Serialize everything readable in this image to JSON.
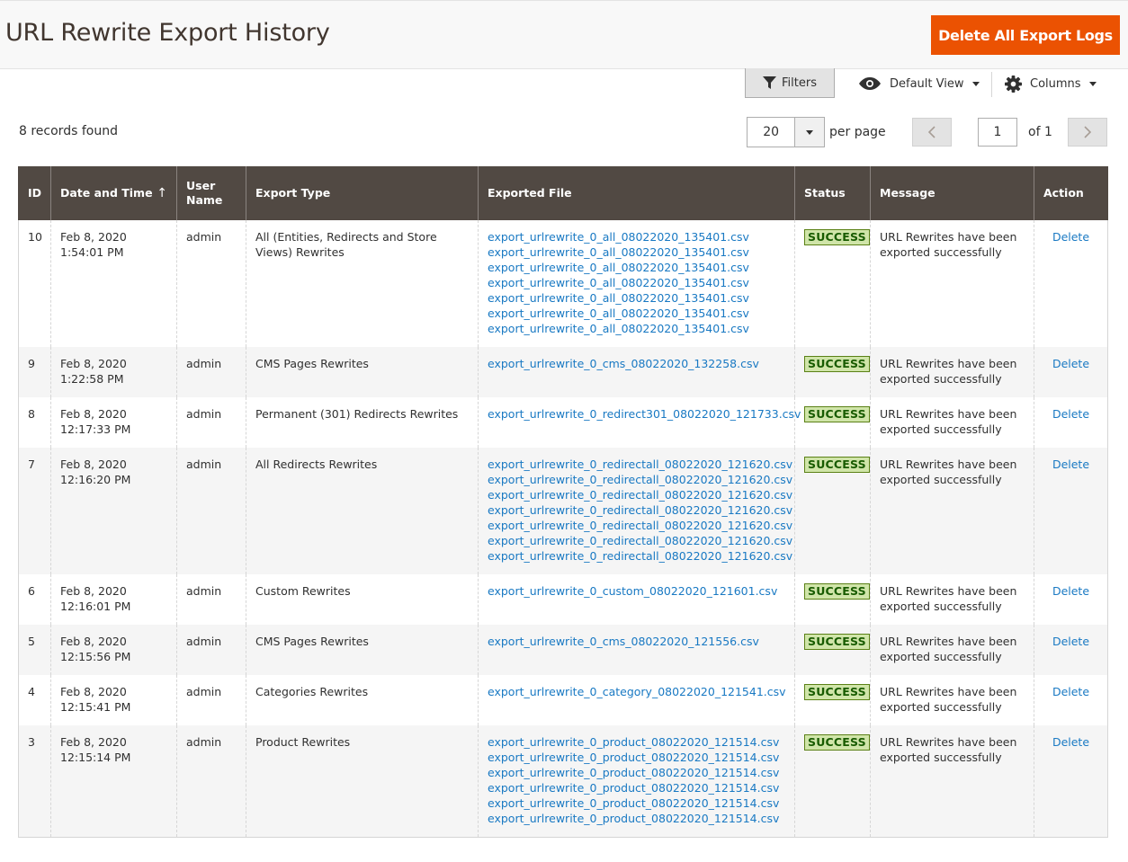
{
  "header": {
    "title": "URL Rewrite Export History",
    "delete_all_label": "Delete All Export Logs"
  },
  "toolbar": {
    "filters_label": "Filters",
    "default_view_label": "Default View",
    "columns_label": "Columns"
  },
  "pager": {
    "records_found": "8 records found",
    "per_page_value": "20",
    "per_page_label": "per page",
    "current_page": "1",
    "of_label": "of 1"
  },
  "grid": {
    "columns": [
      "ID",
      "Date and Time",
      "User Name",
      "Export Type",
      "Exported File",
      "Status",
      "Message",
      "Action"
    ],
    "rows": [
      {
        "id": "10",
        "date": "Feb 8, 2020 1:54:01 PM",
        "user": "admin",
        "type": "All (Entities, Redirects and Store Views) Rewrites",
        "files": [
          "export_urlrewrite_0_all_08022020_135401.csv",
          "export_urlrewrite_0_all_08022020_135401.csv",
          "export_urlrewrite_0_all_08022020_135401.csv",
          "export_urlrewrite_0_all_08022020_135401.csv",
          "export_urlrewrite_0_all_08022020_135401.csv",
          "export_urlrewrite_0_all_08022020_135401.csv",
          "export_urlrewrite_0_all_08022020_135401.csv"
        ],
        "status": "SUCCESS",
        "message": "URL Rewrites have been exported successfully",
        "action": "Delete"
      },
      {
        "id": "9",
        "date": "Feb 8, 2020 1:22:58 PM",
        "user": "admin",
        "type": "CMS Pages Rewrites",
        "files": [
          "export_urlrewrite_0_cms_08022020_132258.csv"
        ],
        "status": "SUCCESS",
        "message": "URL Rewrites have been exported successfully",
        "action": "Delete"
      },
      {
        "id": "8",
        "date": "Feb 8, 2020 12:17:33 PM",
        "user": "admin",
        "type": "Permanent (301) Redirects Rewrites",
        "files": [
          "export_urlrewrite_0_redirect301_08022020_121733.csv"
        ],
        "status": "SUCCESS",
        "message": "URL Rewrites have been exported successfully",
        "action": "Delete"
      },
      {
        "id": "7",
        "date": "Feb 8, 2020 12:16:20 PM",
        "user": "admin",
        "type": "All Redirects Rewrites",
        "files": [
          "export_urlrewrite_0_redirectall_08022020_121620.csv",
          "export_urlrewrite_0_redirectall_08022020_121620.csv",
          "export_urlrewrite_0_redirectall_08022020_121620.csv",
          "export_urlrewrite_0_redirectall_08022020_121620.csv",
          "export_urlrewrite_0_redirectall_08022020_121620.csv",
          "export_urlrewrite_0_redirectall_08022020_121620.csv",
          "export_urlrewrite_0_redirectall_08022020_121620.csv"
        ],
        "status": "SUCCESS",
        "message": "URL Rewrites have been exported successfully",
        "action": "Delete"
      },
      {
        "id": "6",
        "date": "Feb 8, 2020 12:16:01 PM",
        "user": "admin",
        "type": "Custom Rewrites",
        "files": [
          "export_urlrewrite_0_custom_08022020_121601.csv"
        ],
        "status": "SUCCESS",
        "message": "URL Rewrites have been exported successfully",
        "action": "Delete"
      },
      {
        "id": "5",
        "date": "Feb 8, 2020 12:15:56 PM",
        "user": "admin",
        "type": "CMS Pages Rewrites",
        "files": [
          "export_urlrewrite_0_cms_08022020_121556.csv"
        ],
        "status": "SUCCESS",
        "message": "URL Rewrites have been exported successfully",
        "action": "Delete"
      },
      {
        "id": "4",
        "date": "Feb 8, 2020 12:15:41 PM",
        "user": "admin",
        "type": "Categories Rewrites",
        "files": [
          "export_urlrewrite_0_category_08022020_121541.csv"
        ],
        "status": "SUCCESS",
        "message": "URL Rewrites have been exported successfully",
        "action": "Delete"
      },
      {
        "id": "3",
        "date": "Feb 8, 2020 12:15:14 PM",
        "user": "admin",
        "type": "Product Rewrites",
        "files": [
          "export_urlrewrite_0_product_08022020_121514.csv",
          "export_urlrewrite_0_product_08022020_121514.csv",
          "export_urlrewrite_0_product_08022020_121514.csv",
          "export_urlrewrite_0_product_08022020_121514.csv",
          "export_urlrewrite_0_product_08022020_121514.csv",
          "export_urlrewrite_0_product_08022020_121514.csv"
        ],
        "status": "SUCCESS",
        "message": "URL Rewrites have been exported successfully",
        "action": "Delete"
      }
    ]
  },
  "colors": {
    "accent": "#eb5202",
    "header_bg": "#514943",
    "link": "#1979c3",
    "success_bg": "#d0e5a9",
    "success_text": "#185b00"
  },
  "icons": {
    "filter": "filter-icon",
    "eye": "eye-icon",
    "gear": "gear-icon",
    "sort": "sort-arrow-icon"
  }
}
